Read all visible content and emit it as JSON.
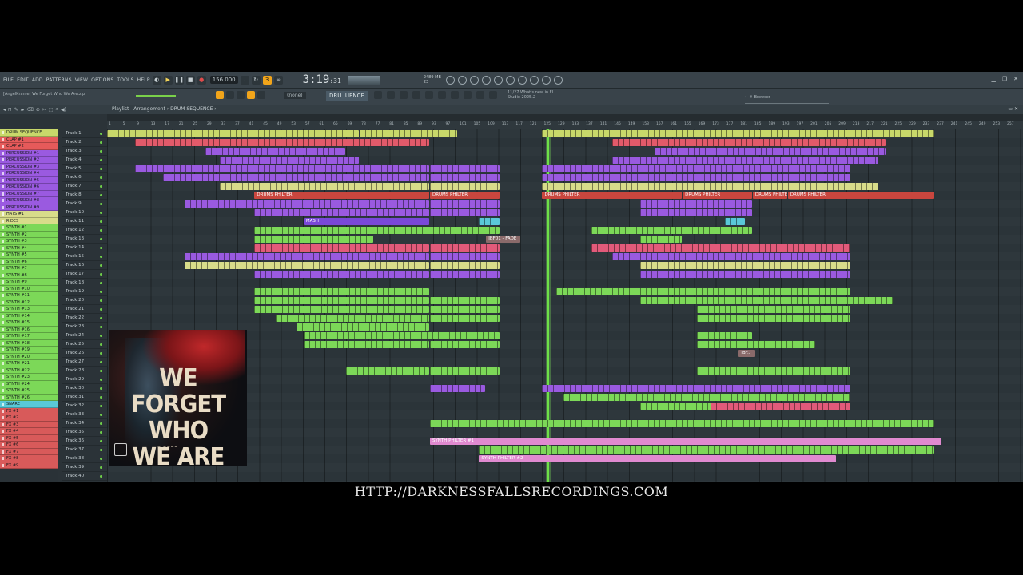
{
  "menu": [
    "FILE",
    "EDIT",
    "ADD",
    "PATTERNS",
    "VIEW",
    "OPTIONS",
    "TOOLS",
    "HELP"
  ],
  "transport": {
    "tempo": "156.000",
    "time": "3:19",
    "time_sub": ":31",
    "mem_line1": "2489 MB",
    "mem_line2": "23"
  },
  "project": {
    "name": "[AngelKrame] We Forget Who We Are.zip",
    "pattern_none": "(none)",
    "pattern": "DRU..UENCE"
  },
  "news": {
    "line1": "11/27  What's new in FL",
    "line2": "Studio 2025.2"
  },
  "browser": {
    "label": "Browser"
  },
  "playlist": {
    "title": "Playlist - Arrangement › DRUM SEQUENCE ›"
  },
  "picker": [
    {
      "name": "DRUM SEQUENCE",
      "color": "#c8d86a"
    },
    {
      "name": "CLAP #1",
      "color": "#e65a5a"
    },
    {
      "name": "CLAP #2",
      "color": "#e65a5a"
    },
    {
      "name": "PERCUSSION #1",
      "color": "#9a5ae0"
    },
    {
      "name": "PERCUSSION #2",
      "color": "#9a5ae0"
    },
    {
      "name": "PERCUSSION #3",
      "color": "#9a5ae0"
    },
    {
      "name": "PERCUSSION #4",
      "color": "#9a5ae0"
    },
    {
      "name": "PERCUSSION #5",
      "color": "#9a5ae0"
    },
    {
      "name": "PERCUSSION #6",
      "color": "#9a5ae0"
    },
    {
      "name": "PERCUSSION #7",
      "color": "#9a5ae0"
    },
    {
      "name": "PERCUSSION #8",
      "color": "#9a5ae0"
    },
    {
      "name": "PERCUSSION #9",
      "color": "#9a5ae0"
    },
    {
      "name": "HATS #1",
      "color": "#d8dc8a"
    },
    {
      "name": "RIDES",
      "color": "#d8dc8a"
    },
    {
      "name": "SYNTH #1",
      "color": "#7cd858"
    },
    {
      "name": "SYNTH #2",
      "color": "#7cd858"
    },
    {
      "name": "SYNTH #3",
      "color": "#7cd858"
    },
    {
      "name": "SYNTH #4",
      "color": "#7cd858"
    },
    {
      "name": "SYNTH #5",
      "color": "#7cd858"
    },
    {
      "name": "SYNTH #6",
      "color": "#7cd858"
    },
    {
      "name": "SYNTH #7",
      "color": "#7cd858"
    },
    {
      "name": "SYNTH #8",
      "color": "#7cd858"
    },
    {
      "name": "SYNTH #9",
      "color": "#7cd858"
    },
    {
      "name": "SYNTH #10",
      "color": "#7cd858"
    },
    {
      "name": "SYNTH #11",
      "color": "#7cd858"
    },
    {
      "name": "SYNTH #12",
      "color": "#7cd858"
    },
    {
      "name": "SYNTH #13",
      "color": "#7cd858"
    },
    {
      "name": "SYNTH #14",
      "color": "#7cd858"
    },
    {
      "name": "SYNTH #15",
      "color": "#7cd858"
    },
    {
      "name": "SYNTH #16",
      "color": "#7cd858"
    },
    {
      "name": "SYNTH #17",
      "color": "#7cd858"
    },
    {
      "name": "SYNTH #18",
      "color": "#7cd858"
    },
    {
      "name": "SYNTH #19",
      "color": "#7cd858"
    },
    {
      "name": "SYNTH #20",
      "color": "#7cd858"
    },
    {
      "name": "SYNTH #21",
      "color": "#7cd858"
    },
    {
      "name": "SYNTH #22",
      "color": "#7cd858"
    },
    {
      "name": "SYNTH #23",
      "color": "#7cd858"
    },
    {
      "name": "SYNTH #24",
      "color": "#7cd858"
    },
    {
      "name": "SYNTH #25",
      "color": "#7cd858"
    },
    {
      "name": "SYNTH #26",
      "color": "#7cd858"
    },
    {
      "name": "SNARE",
      "color": "#5ac8d8"
    },
    {
      "name": "FX #1",
      "color": "#d85a5a"
    },
    {
      "name": "FX #2",
      "color": "#d85a5a"
    },
    {
      "name": "FX #3",
      "color": "#d85a5a"
    },
    {
      "name": "FX #4",
      "color": "#d85a5a"
    },
    {
      "name": "FX #5",
      "color": "#d85a5a"
    },
    {
      "name": "FX #6",
      "color": "#d85a5a"
    },
    {
      "name": "FX #7",
      "color": "#d85a5a"
    },
    {
      "name": "FX #8",
      "color": "#d85a5a"
    },
    {
      "name": "FX #9",
      "color": "#d85a5a"
    }
  ],
  "tracks": [
    "Track 1",
    "Track 2",
    "Track 3",
    "Track 4",
    "Track 5",
    "Track 6",
    "Track 7",
    "Track 8",
    "Track 9",
    "Track 10",
    "Track 11",
    "Track 12",
    "Track 13",
    "Track 14",
    "Track 15",
    "Track 16",
    "Track 17",
    "Track 18",
    "Track 19",
    "Track 20",
    "Track 21",
    "Track 22",
    "Track 23",
    "Track 24",
    "Track 25",
    "Track 26",
    "Track 27",
    "Track 28",
    "Track 29",
    "Track 30",
    "Track 31",
    "Track 32",
    "Track 33",
    "Track 34",
    "Track 35",
    "Track 36",
    "Track 37",
    "Track 38",
    "Track 39",
    "Track 40"
  ],
  "ruler": [
    "1",
    "5",
    "9",
    "13",
    "17",
    "21",
    "25",
    "29",
    "33",
    "37",
    "41",
    "45",
    "49",
    "53",
    "57",
    "61",
    "65",
    "69",
    "73",
    "77",
    "81",
    "85",
    "89",
    "93",
    "97",
    "101",
    "105",
    "109",
    "113",
    "117",
    "121",
    "125",
    "129",
    "133",
    "137",
    "141",
    "145",
    "149",
    "153",
    "157",
    "161",
    "165",
    "169",
    "173",
    "177",
    "181",
    "185",
    "189",
    "193",
    "197",
    "201",
    "205",
    "209",
    "213",
    "217",
    "221",
    "225",
    "229",
    "233",
    "237",
    "241",
    "245",
    "249",
    "253",
    "257"
  ],
  "clips": [
    {
      "track": 0,
      "start": 1,
      "end": 73,
      "color": "#c8d86a"
    },
    {
      "track": 0,
      "start": 73,
      "end": 101,
      "color": "#c8d86a"
    },
    {
      "track": 0,
      "start": 125,
      "end": 237,
      "color": "#c8d86a"
    },
    {
      "track": 1,
      "start": 9,
      "end": 93,
      "color": "#e25a6a"
    },
    {
      "track": 1,
      "start": 145,
      "end": 223,
      "color": "#e25a6a"
    },
    {
      "track": 2,
      "start": 29,
      "end": 69,
      "color": "#9a5ae0"
    },
    {
      "track": 2,
      "start": 157,
      "end": 223,
      "color": "#9a5ae0"
    },
    {
      "track": 3,
      "start": 33,
      "end": 73,
      "color": "#9a5ae0"
    },
    {
      "track": 3,
      "start": 145,
      "end": 221,
      "color": "#9a5ae0"
    },
    {
      "track": 4,
      "start": 9,
      "end": 93,
      "color": "#9a5ae0"
    },
    {
      "track": 4,
      "start": 93,
      "end": 113,
      "color": "#9a5ae0"
    },
    {
      "track": 4,
      "start": 125,
      "end": 213,
      "color": "#9a5ae0"
    },
    {
      "track": 5,
      "start": 17,
      "end": 93,
      "color": "#9a5ae0"
    },
    {
      "track": 5,
      "start": 93,
      "end": 113,
      "color": "#9a5ae0"
    },
    {
      "track": 5,
      "start": 125,
      "end": 213,
      "color": "#9a5ae0"
    },
    {
      "track": 6,
      "start": 33,
      "end": 93,
      "color": "#d8dc8a"
    },
    {
      "track": 6,
      "start": 93,
      "end": 113,
      "color": "#d8dc8a"
    },
    {
      "track": 6,
      "start": 125,
      "end": 221,
      "color": "#d8dc8a"
    },
    {
      "track": 7,
      "start": 43,
      "end": 93,
      "color": "#c9463e",
      "label": "DRUMS PHILTER"
    },
    {
      "track": 7,
      "start": 93,
      "end": 113,
      "color": "#c9463e",
      "label": "DRUMS PHILTER"
    },
    {
      "track": 7,
      "start": 125,
      "end": 165,
      "color": "#c9463e",
      "label": "DRUMS PHILTER"
    },
    {
      "track": 7,
      "start": 165,
      "end": 185,
      "color": "#c9463e",
      "label": "DRUMS PHILTER"
    },
    {
      "track": 7,
      "start": 185,
      "end": 195,
      "color": "#c9463e",
      "label": "DRUMS PHILTER"
    },
    {
      "track": 7,
      "start": 195,
      "end": 237,
      "color": "#c9463e",
      "label": "DRUMS PHILTER"
    },
    {
      "track": 8,
      "start": 23,
      "end": 93,
      "color": "#9a5ae0"
    },
    {
      "track": 8,
      "start": 93,
      "end": 113,
      "color": "#9a5ae0"
    },
    {
      "track": 8,
      "start": 153,
      "end": 185,
      "color": "#9a5ae0"
    },
    {
      "track": 9,
      "start": 43,
      "end": 93,
      "color": "#9a5ae0"
    },
    {
      "track": 9,
      "start": 93,
      "end": 113,
      "color": "#9a5ae0"
    },
    {
      "track": 9,
      "start": 153,
      "end": 185,
      "color": "#9a5ae0"
    },
    {
      "track": 10,
      "start": 57,
      "end": 93,
      "color": "#7a48d8",
      "label": "MASH"
    },
    {
      "track": 10,
      "start": 107,
      "end": 113,
      "color": "#5ac8d8"
    },
    {
      "track": 10,
      "start": 177,
      "end": 183,
      "color": "#5ac8d8"
    },
    {
      "track": 11,
      "start": 43,
      "end": 113,
      "color": "#7cd858"
    },
    {
      "track": 11,
      "start": 139,
      "end": 185,
      "color": "#7cd858"
    },
    {
      "track": 12,
      "start": 43,
      "end": 77,
      "color": "#7cd858"
    },
    {
      "track": 12,
      "start": 153,
      "end": 165,
      "color": "#7cd858"
    },
    {
      "track": 12,
      "start": 109,
      "end": 119,
      "color": "#8a6a6a",
      "label": "IBF01 - FADE"
    },
    {
      "track": 13,
      "start": 43,
      "end": 93,
      "color": "#e25a7a"
    },
    {
      "track": 13,
      "start": 93,
      "end": 113,
      "color": "#e25a7a"
    },
    {
      "track": 13,
      "start": 139,
      "end": 213,
      "color": "#e25a7a"
    },
    {
      "track": 14,
      "start": 23,
      "end": 93,
      "color": "#9a5ae0"
    },
    {
      "track": 14,
      "start": 93,
      "end": 113,
      "color": "#9a5ae0"
    },
    {
      "track": 14,
      "start": 145,
      "end": 213,
      "color": "#9a5ae0"
    },
    {
      "track": 15,
      "start": 23,
      "end": 93,
      "color": "#d8dc8a"
    },
    {
      "track": 15,
      "start": 93,
      "end": 113,
      "color": "#d8dc8a"
    },
    {
      "track": 15,
      "start": 153,
      "end": 213,
      "color": "#d8dc8a"
    },
    {
      "track": 16,
      "start": 43,
      "end": 93,
      "color": "#9a5ae0"
    },
    {
      "track": 16,
      "start": 93,
      "end": 113,
      "color": "#9a5ae0"
    },
    {
      "track": 16,
      "start": 153,
      "end": 213,
      "color": "#9a5ae0"
    },
    {
      "track": 18,
      "start": 43,
      "end": 93,
      "color": "#7cd858"
    },
    {
      "track": 18,
      "start": 129,
      "end": 213,
      "color": "#7cd858"
    },
    {
      "track": 19,
      "start": 43,
      "end": 93,
      "color": "#7cd858"
    },
    {
      "track": 19,
      "start": 93,
      "end": 113,
      "color": "#7cd858"
    },
    {
      "track": 19,
      "start": 153,
      "end": 225,
      "color": "#7cd858"
    },
    {
      "track": 20,
      "start": 43,
      "end": 93,
      "color": "#7cd858"
    },
    {
      "track": 20,
      "start": 93,
      "end": 113,
      "color": "#7cd858"
    },
    {
      "track": 20,
      "start": 169,
      "end": 213,
      "color": "#7cd858"
    },
    {
      "track": 21,
      "start": 49,
      "end": 93,
      "color": "#7cd858"
    },
    {
      "track": 21,
      "start": 93,
      "end": 113,
      "color": "#7cd858"
    },
    {
      "track": 21,
      "start": 169,
      "end": 213,
      "color": "#7cd858"
    },
    {
      "track": 22,
      "start": 55,
      "end": 93,
      "color": "#7cd858"
    },
    {
      "track": 23,
      "start": 57,
      "end": 113,
      "color": "#7cd858"
    },
    {
      "track": 23,
      "start": 169,
      "end": 185,
      "color": "#7cd858"
    },
    {
      "track": 24,
      "start": 57,
      "end": 93,
      "color": "#7cd858"
    },
    {
      "track": 24,
      "start": 93,
      "end": 113,
      "color": "#7cd858"
    },
    {
      "track": 24,
      "start": 169,
      "end": 203,
      "color": "#7cd858"
    },
    {
      "track": 25,
      "start": 181,
      "end": 186,
      "color": "#8a6a6a",
      "label": "IBF.."
    },
    {
      "track": 27,
      "start": 69,
      "end": 93,
      "color": "#7cd858"
    },
    {
      "track": 27,
      "start": 93,
      "end": 113,
      "color": "#7cd858"
    },
    {
      "track": 27,
      "start": 169,
      "end": 213,
      "color": "#7cd858"
    },
    {
      "track": 29,
      "start": 93,
      "end": 109,
      "color": "#9a5ae0"
    },
    {
      "track": 29,
      "start": 125,
      "end": 213,
      "color": "#9a5ae0"
    },
    {
      "track": 30,
      "start": 131,
      "end": 213,
      "color": "#7cd858"
    },
    {
      "track": 31,
      "start": 153,
      "end": 213,
      "color": "#7cd858"
    },
    {
      "track": 31,
      "start": 173,
      "end": 213,
      "color": "#e25a7a"
    },
    {
      "track": 33,
      "start": 93,
      "end": 237,
      "color": "#7cd858"
    },
    {
      "track": 35,
      "start": 93,
      "end": 239,
      "color": "#e08ad0",
      "label": "SYNTH PHILTER #1"
    },
    {
      "track": 36,
      "start": 107,
      "end": 237,
      "color": "#7cd858"
    },
    {
      "track": 37,
      "start": 107,
      "end": 209,
      "color": "#e08ad0",
      "label": "SYNTH PHILTER #2"
    }
  ],
  "playhead_bar": 126,
  "cover": {
    "line1": "WE FORGET",
    "line2": "WHO",
    "line3": "WE ARE"
  },
  "footer_url": "HTTP://DARKNESSFALLSRECORDINGS.COM"
}
